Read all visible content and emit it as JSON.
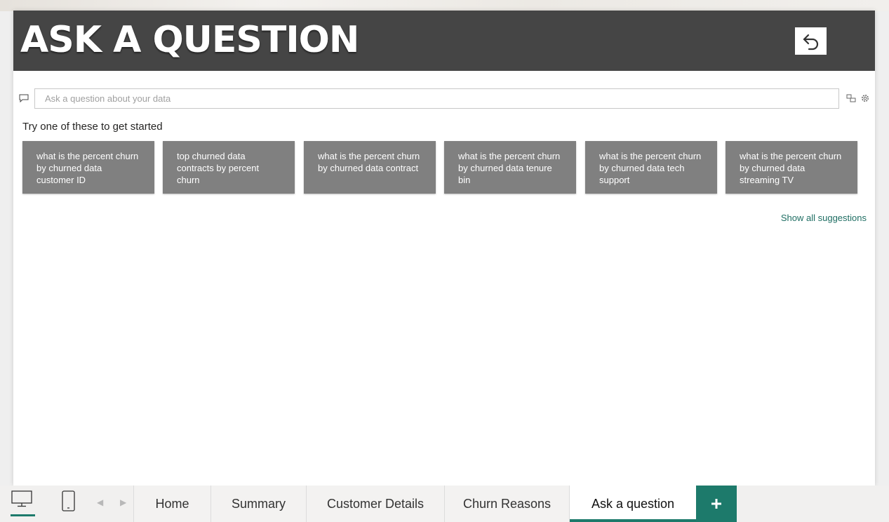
{
  "header": {
    "title": "ASK A QUESTION",
    "back_icon": "undo-arrow-icon"
  },
  "qa": {
    "placeholder": "Ask a question about your data",
    "value": "",
    "prompt": "Try one of these to get started",
    "suggestions": [
      "what is the percent churn by churned data customer ID",
      "top churned data contracts by percent churn",
      "what is the percent churn by churned data contract",
      "what is the percent churn by churned data tenure bin",
      "what is the percent churn by churned data tech support",
      "what is the percent churn by churned data streaming TV"
    ],
    "show_all": "Show all suggestions",
    "icons": [
      "chat-icon",
      "convert-visual-icon",
      "settings-gear-icon"
    ]
  },
  "tabs": {
    "pages": [
      "Home",
      "Summary",
      "Customer Details",
      "Churn Reasons",
      "Ask a question"
    ],
    "active": "Ask a question",
    "add_symbol": "+",
    "view_icons": [
      "desktop-view-icon",
      "mobile-view-icon"
    ],
    "nav_icons": [
      "prev-page-icon",
      "next-page-icon"
    ]
  },
  "colors": {
    "header_bg": "#454545",
    "suggestion_bg": "#808080",
    "accent": "#1d7a6b",
    "link": "#1f6e63"
  }
}
